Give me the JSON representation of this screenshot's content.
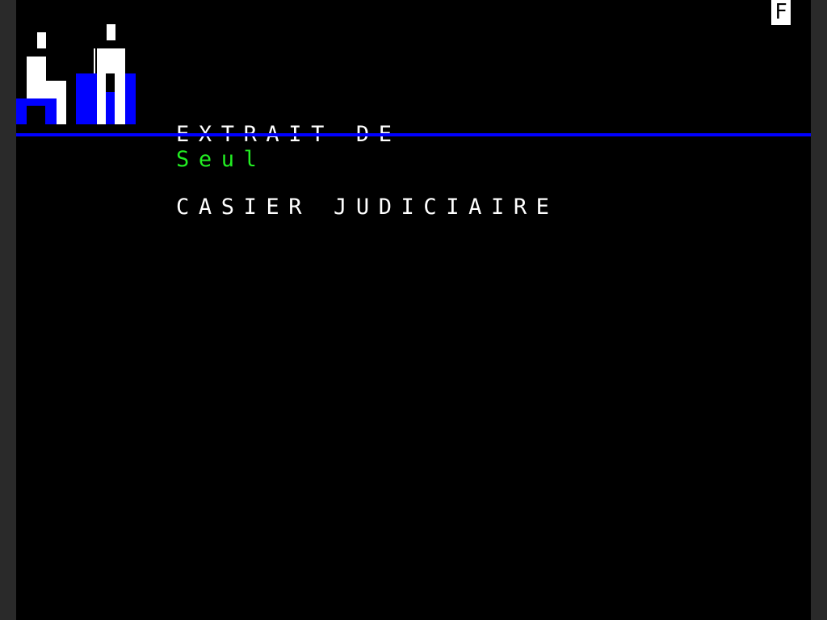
{
  "mode_indicator": "F",
  "header": {
    "title_line_1": "EXTRAIT DE",
    "title_line_2": "CASIER JUDICIAIRE"
  },
  "content": {
    "subtitle": "Seul"
  },
  "logo": {
    "icon": "courtroom-figures-icon"
  },
  "colors": {
    "background": "#000000",
    "title_text": "#ffffff",
    "divider": "#0000ff",
    "subtitle_text": "#22ee22",
    "logo_white": "#ffffff",
    "logo_blue": "#0000ff"
  }
}
